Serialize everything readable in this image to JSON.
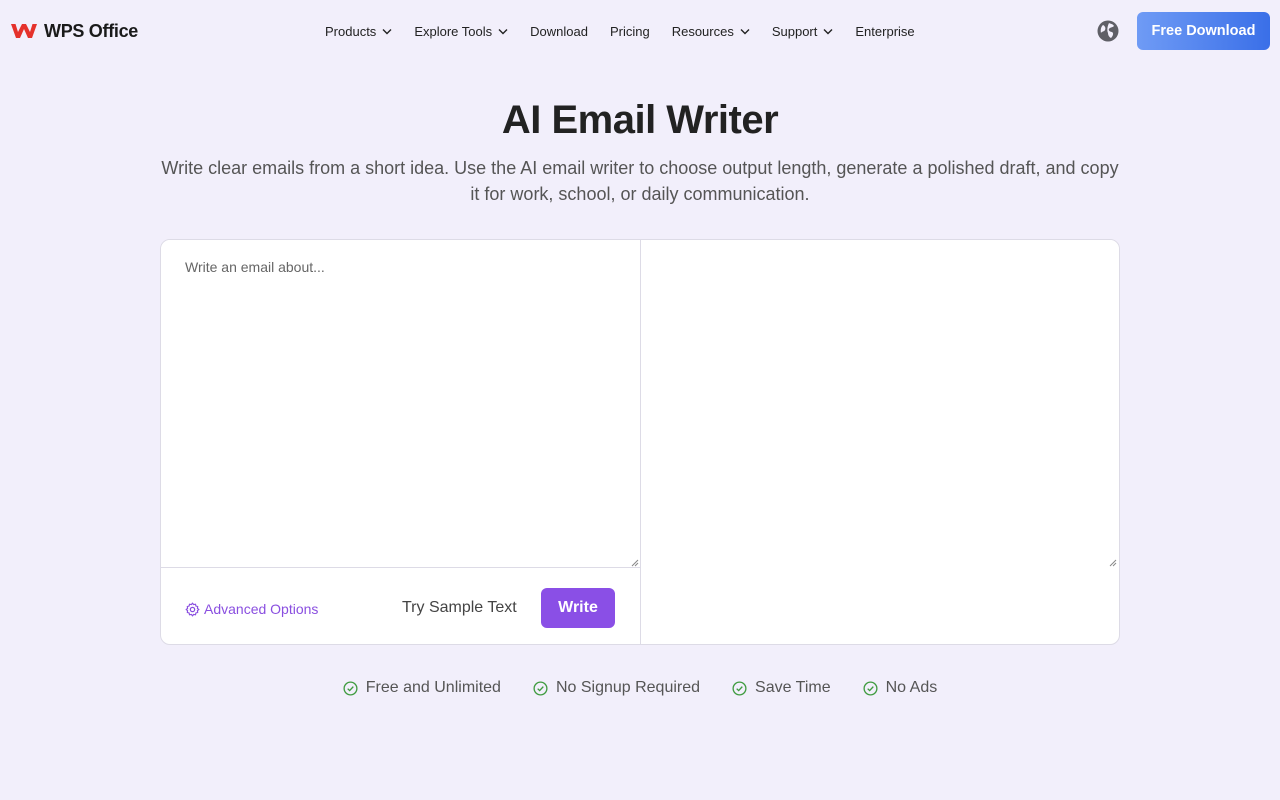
{
  "header": {
    "brand": "WPS Office",
    "nav": [
      {
        "label": "Products",
        "dropdown": true
      },
      {
        "label": "Explore Tools",
        "dropdown": true
      },
      {
        "label": "Download",
        "dropdown": false
      },
      {
        "label": "Pricing",
        "dropdown": false
      },
      {
        "label": "Resources",
        "dropdown": true
      },
      {
        "label": "Support",
        "dropdown": true
      },
      {
        "label": "Enterprise",
        "dropdown": false
      }
    ],
    "language_icon": "globe-icon",
    "cta_label": "Free Download"
  },
  "hero": {
    "title": "AI Email Writer",
    "subtitle": "Write clear emails from a short idea. Use the AI email writer to choose output length, generate a polished draft, and copy it for work, school, or daily communication."
  },
  "editor": {
    "input_placeholder": "Write an email about...",
    "input_value": "",
    "output_value": "",
    "advanced_label": "Advanced Options",
    "sample_label": "Try Sample Text",
    "write_label": "Write"
  },
  "features": [
    {
      "label": "Free and Unlimited",
      "icon": "check-circle-icon"
    },
    {
      "label": "No Signup Required",
      "icon": "check-circle-icon"
    },
    {
      "label": "Save Time",
      "icon": "check-circle-icon"
    },
    {
      "label": "No Ads",
      "icon": "check-circle-icon"
    }
  ],
  "colors": {
    "brand_red": "#e5312b",
    "accent_purple": "#8a4fe6",
    "cta_blue": "#3a6fe8",
    "check_green": "#3f9b3f",
    "background": "#f2effb"
  }
}
